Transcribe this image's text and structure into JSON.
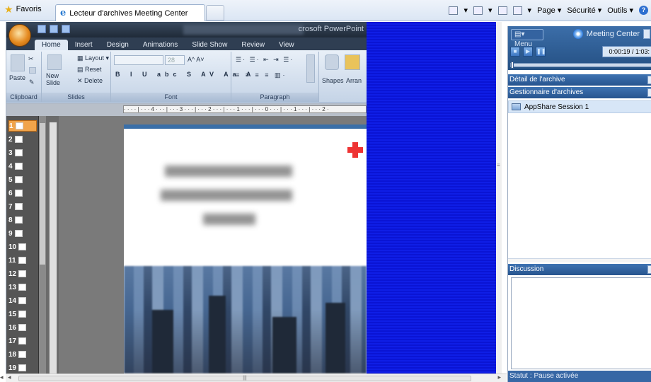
{
  "browser": {
    "favorites_label": "Favoris",
    "tab_title": "Lecteur d'archives Meeting Center",
    "commands": {
      "page": "Page ▾",
      "security": "Sécurité ▾",
      "tools": "Outils ▾",
      "help": "?"
    }
  },
  "powerpoint": {
    "app_title": "crosoft PowerPoint",
    "tabs": [
      "Home",
      "Insert",
      "Design",
      "Animations",
      "Slide Show",
      "Review",
      "View"
    ],
    "active_tab": "Home",
    "groups": {
      "clipboard": "Clipboard",
      "slides": "Slides",
      "font": "Font",
      "paragraph": "Paragraph"
    },
    "buttons": {
      "paste": "Paste",
      "new_slide": "New\nSlide",
      "layout": "Layout",
      "reset": "Reset",
      "delete": "Delete",
      "font_size": "28",
      "shapes": "Shapes",
      "arrange": "Arran"
    },
    "ruler_text": "· · · · | · · · 4 · · · | · · · 3 · · · | · · · 2 · · · | · · · 1 · · · | · · · 0 · · · | · · · 1 · · · | · · · 2 ·",
    "slides": [
      "1",
      "2",
      "3",
      "4",
      "5",
      "6",
      "7",
      "8",
      "9",
      "10",
      "11",
      "12",
      "13",
      "14",
      "15",
      "16",
      "17",
      "18",
      "19"
    ],
    "selected_slide": "1"
  },
  "meeting_panel": {
    "menu_label": "Menu",
    "brand": "Meeting Center",
    "time": "0:00:19 / 1:03:",
    "sections": {
      "details": "Détail de l'archive",
      "manager": "Gestionnaire d'archives",
      "discussion": "Discussion"
    },
    "archive_item": "AppShare Session 1",
    "status": "Statut : Pause activée"
  },
  "colors": {
    "blue_fill": "#0a14d4",
    "panel_header": "#3c6ea9",
    "accent_orange": "#f1a44a"
  }
}
